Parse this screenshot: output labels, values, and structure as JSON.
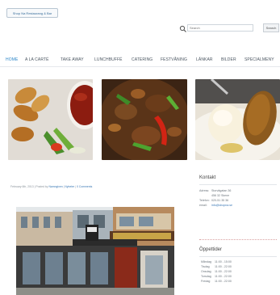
{
  "header": {
    "logo_label": "Shop Na Restaurang & Bar"
  },
  "search": {
    "placeholder": "Search",
    "button_label": "Search"
  },
  "nav": {
    "items": [
      {
        "label": "HOME",
        "active": true
      },
      {
        "label": "A LA CARTÉ"
      },
      {
        "label": "TAKE AWAY"
      },
      {
        "label": "LUNCHBUFFÉ"
      },
      {
        "label": "CATERING"
      },
      {
        "label": "FESTVÅNING"
      },
      {
        "label": "LÄNKAR"
      },
      {
        "label": "BILDER"
      },
      {
        "label": "SPECIALMENY"
      }
    ]
  },
  "post": {
    "date_prefix": "February 6th, 2013 | Posted by",
    "author": "Namngiven",
    "sep1": "|",
    "category": "Nyheter",
    "sep2": "|",
    "comments": "0 Comments"
  },
  "sidebar": {
    "contact_title": "Kontakt",
    "contact_rows": [
      {
        "label": "Adress:",
        "value": "Storvägatan 36"
      },
      {
        "label": "",
        "value": "456 32 Skene"
      },
      {
        "label": "Telefon:",
        "value": "020-51 35 36"
      },
      {
        "label": "email:",
        "value": "info@shopna.se"
      }
    ],
    "hours_title": "Öppettider",
    "hours_rows": [
      {
        "label": "Måndag",
        "value": "11:00 - 15:00"
      },
      {
        "label": "Tisdag",
        "value": "11:00 - 22:00"
      },
      {
        "label": "Onsdag",
        "value": "11:00 - 22:00"
      },
      {
        "label": "Torsdag",
        "value": "11:00 - 22:00"
      },
      {
        "label": "Fredag",
        "value": "11:00 - 22:00"
      }
    ]
  },
  "colors": {
    "accent": "#2c86c8",
    "nav_text": "#4a5560",
    "link": "#3a78b5"
  }
}
